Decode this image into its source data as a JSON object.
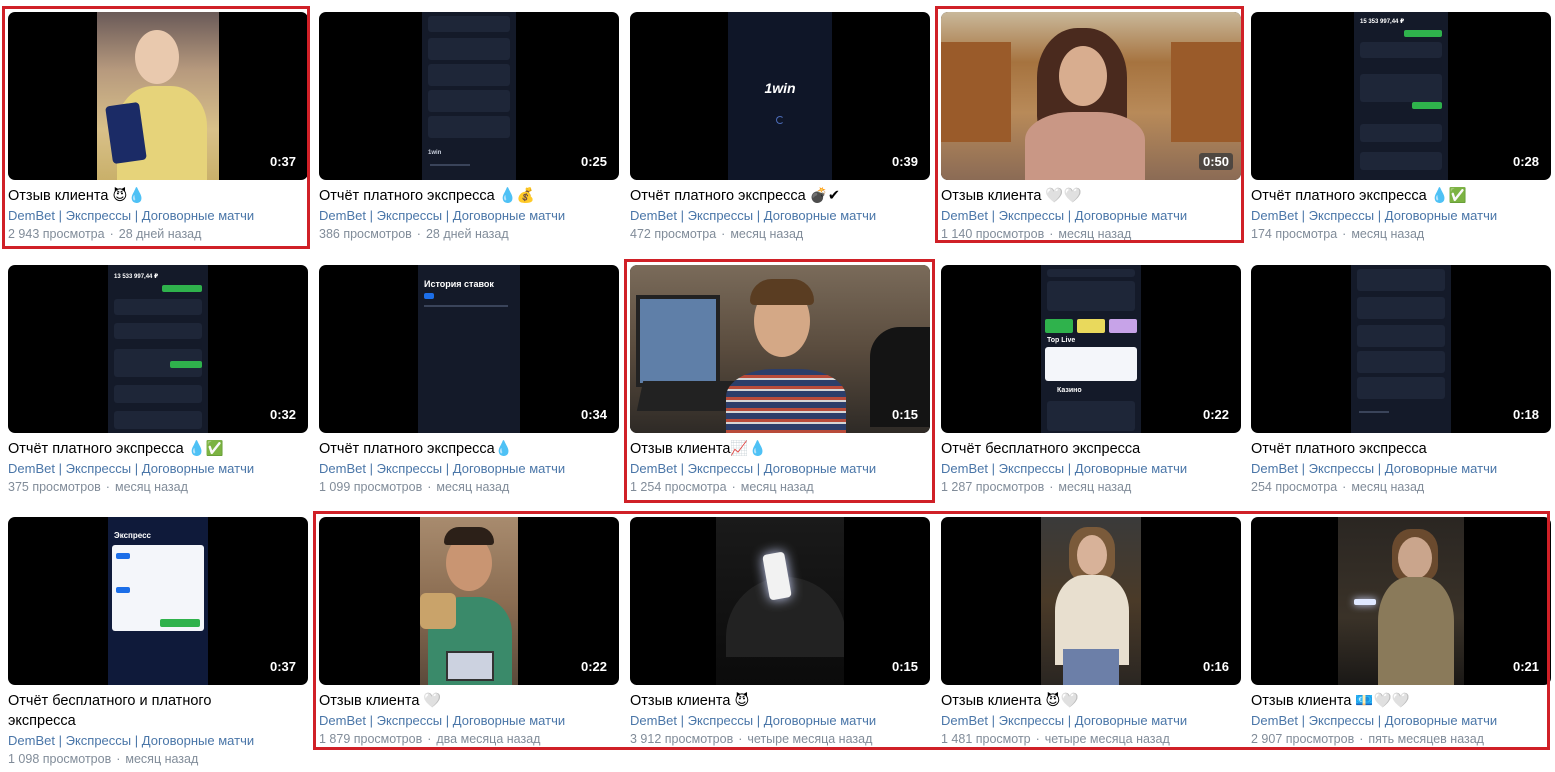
{
  "tags": {
    "a": "DemBet",
    "b": "Экспрессы",
    "c": "Договорные матчи",
    "sep": "|"
  },
  "ui_text": {
    "logo": "1win",
    "bet_history": "История ставок",
    "balance": "13 533 997,44 ₽",
    "balance2": "15 353 997,44 ₽",
    "top_live": "Top Live",
    "casino": "Казино",
    "express": "Экспресс"
  },
  "videos": [
    {
      "title": "Отзыв клиента 😈💧",
      "duration": "0:37",
      "views": "2 943 просмотра",
      "age": "28 дней назад"
    },
    {
      "title": "Отчёт платного экспресса 💧💰",
      "duration": "0:25",
      "views": "386 просмотров",
      "age": "28 дней назад"
    },
    {
      "title": "Отчёт платного экспресса 💣✔",
      "duration": "0:39",
      "views": "472 просмотра",
      "age": "месяц назад"
    },
    {
      "title": "Отзыв клиента 🤍🤍",
      "duration": "0:50",
      "views": "1 140 просмотров",
      "age": "месяц назад"
    },
    {
      "title": "Отчёт платного экспресса 💧✅",
      "duration": "0:28",
      "views": "174 просмотра",
      "age": "месяц назад"
    },
    {
      "title": "Отчёт платного экспресса 💧✅",
      "duration": "0:32",
      "views": "375 просмотров",
      "age": "месяц назад"
    },
    {
      "title": "Отчёт платного экспресса💧",
      "duration": "0:34",
      "views": "1 099 просмотров",
      "age": "месяц назад"
    },
    {
      "title": "Отзыв клиента📈💧",
      "duration": "0:15",
      "views": "1 254 просмотра",
      "age": "месяц назад"
    },
    {
      "title": "Отчёт бесплатного экспресса",
      "duration": "0:22",
      "views": "1 287 просмотров",
      "age": "месяц назад"
    },
    {
      "title": "Отчёт платного экспресса",
      "duration": "0:18",
      "views": "254 просмотра",
      "age": "месяц назад"
    },
    {
      "title": "Отчёт бесплатного и платного экспресса",
      "duration": "0:37",
      "views": "1 098 просмотров",
      "age": "месяц назад"
    },
    {
      "title": "Отзыв клиента 🤍",
      "duration": "0:22",
      "views": "1 879 просмотров",
      "age": "два месяца назад"
    },
    {
      "title": "Отзыв клиента 😈",
      "duration": "0:15",
      "views": "3 912 просмотров",
      "age": "четыре месяца назад"
    },
    {
      "title": "Отзыв клиента 😈🤍",
      "duration": "0:16",
      "views": "1 481 просмотр",
      "age": "четыре месяца назад"
    },
    {
      "title": "Отзыв клиента 💶🤍🤍",
      "duration": "0:21",
      "views": "2 907 просмотров",
      "age": "пять месяцев назад"
    }
  ]
}
